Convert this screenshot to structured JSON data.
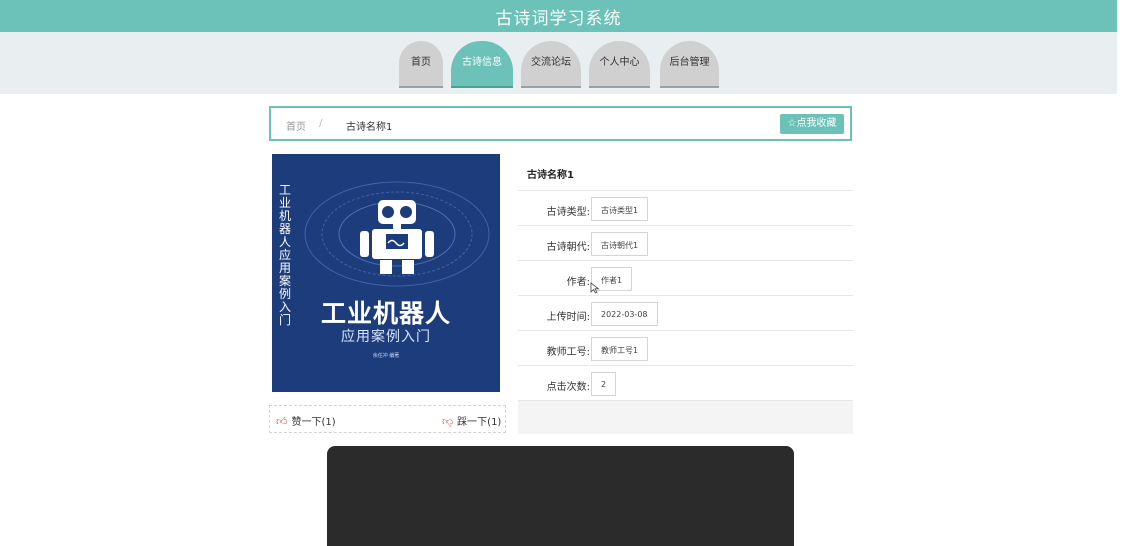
{
  "header": {
    "title": "古诗词学习系统"
  },
  "nav": {
    "tabs": [
      {
        "label": "首页"
      },
      {
        "label": "古诗信息"
      },
      {
        "label": "交流论坛"
      },
      {
        "label": "个人中心"
      },
      {
        "label": "后台管理"
      }
    ],
    "active_tab": "古诗信息"
  },
  "breadcrumb": {
    "home": "首页",
    "separator": "/",
    "current": "古诗名称1"
  },
  "favorite_button": {
    "icon": "star-outline-icon",
    "label": "☆点我收藏"
  },
  "cover": {
    "vertical_text": "工业机器人应用案例入门",
    "title": "工业机器人",
    "subtitle": "应用案例入门",
    "author": "余任冲 编著"
  },
  "votes": {
    "like_label": "赞一下(1)",
    "like_icon": "thumbs-up-icon",
    "dislike_label": "踩一下(1)",
    "dislike_icon": "thumbs-down-icon"
  },
  "details": {
    "title": "古诗名称1",
    "rows": [
      {
        "label": "古诗类型:",
        "value": "古诗类型1"
      },
      {
        "label": "古诗朝代:",
        "value": "古诗朝代1"
      },
      {
        "label": "作者:",
        "value": "作者1"
      },
      {
        "label": "上传时间:",
        "value": "2022-03-08"
      },
      {
        "label": "教师工号:",
        "value": "教师工号1"
      },
      {
        "label": "点击次数:",
        "value": "2"
      }
    ]
  },
  "colors": {
    "accent": "#6cc1b8",
    "cover": "#1d3c7c",
    "vote_icon": "#e55656"
  }
}
